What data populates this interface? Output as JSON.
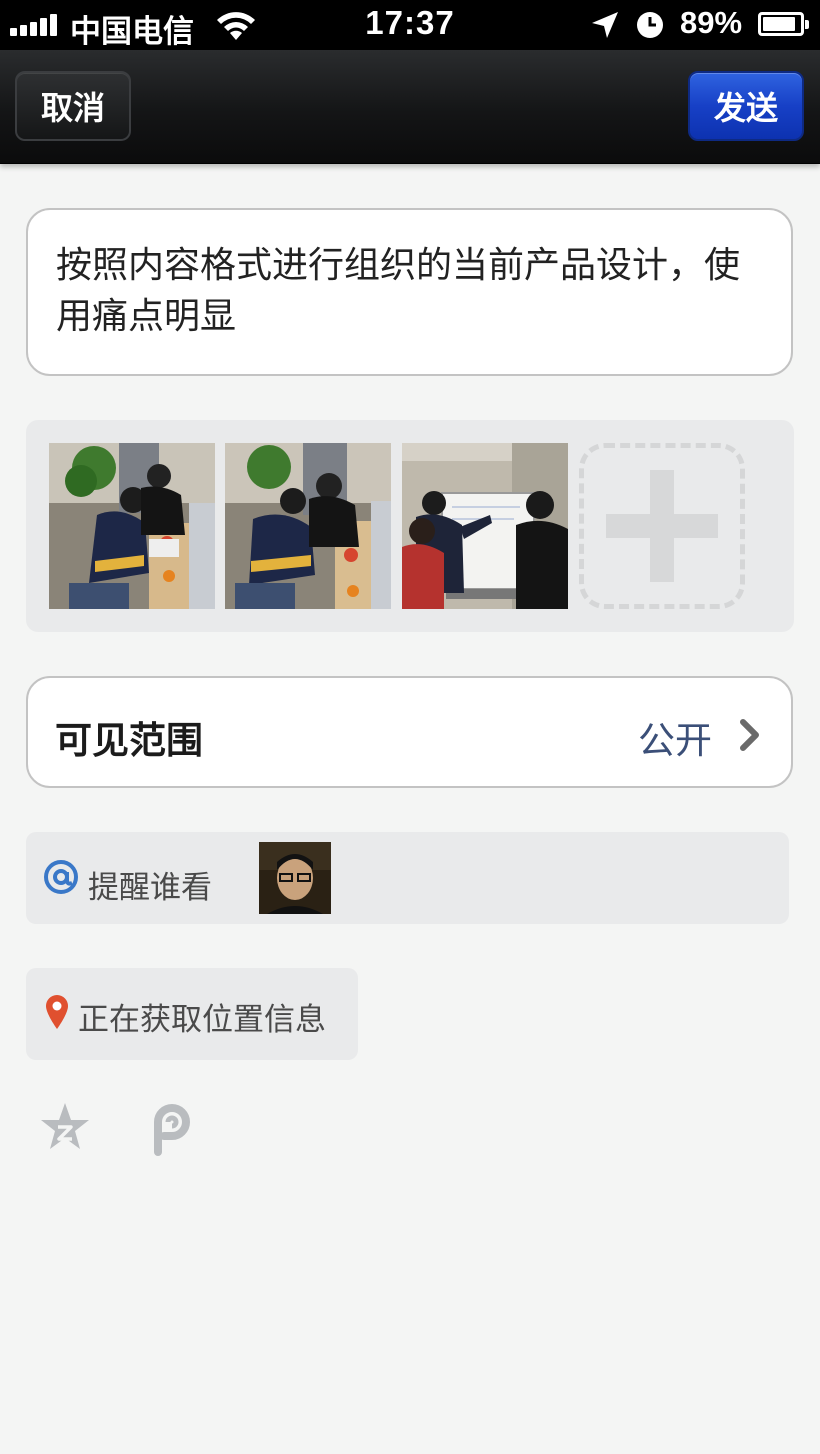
{
  "status_bar": {
    "carrier": "中国电信",
    "time": "17:37",
    "battery_percent": "89%",
    "battery_level": 0.89,
    "signal_bars": 5,
    "icons": [
      "signal-icon",
      "wifi-icon",
      "location-arrow-icon",
      "alarm-clock-icon",
      "battery-icon"
    ]
  },
  "nav": {
    "cancel_label": "取消",
    "send_label": "发送"
  },
  "compose": {
    "text": "按照内容格式进行组织的当前产品设计，使用痛点明显"
  },
  "photos": {
    "count": 3,
    "add_icon": "plus-icon"
  },
  "visibility": {
    "label": "可见范围",
    "value": "公开",
    "icon": "chevron-right-icon"
  },
  "mention": {
    "icon": "at-icon",
    "label": "提醒谁看"
  },
  "location": {
    "icon": "map-pin-icon",
    "label": "正在获取位置信息"
  },
  "toolbar": {
    "icons": [
      "star-icon",
      "p-icon"
    ]
  },
  "colors": {
    "send_button": "#1a44c8",
    "link_value": "#3b4f78",
    "pin": "#e0502f",
    "at": "#3a78c8"
  }
}
